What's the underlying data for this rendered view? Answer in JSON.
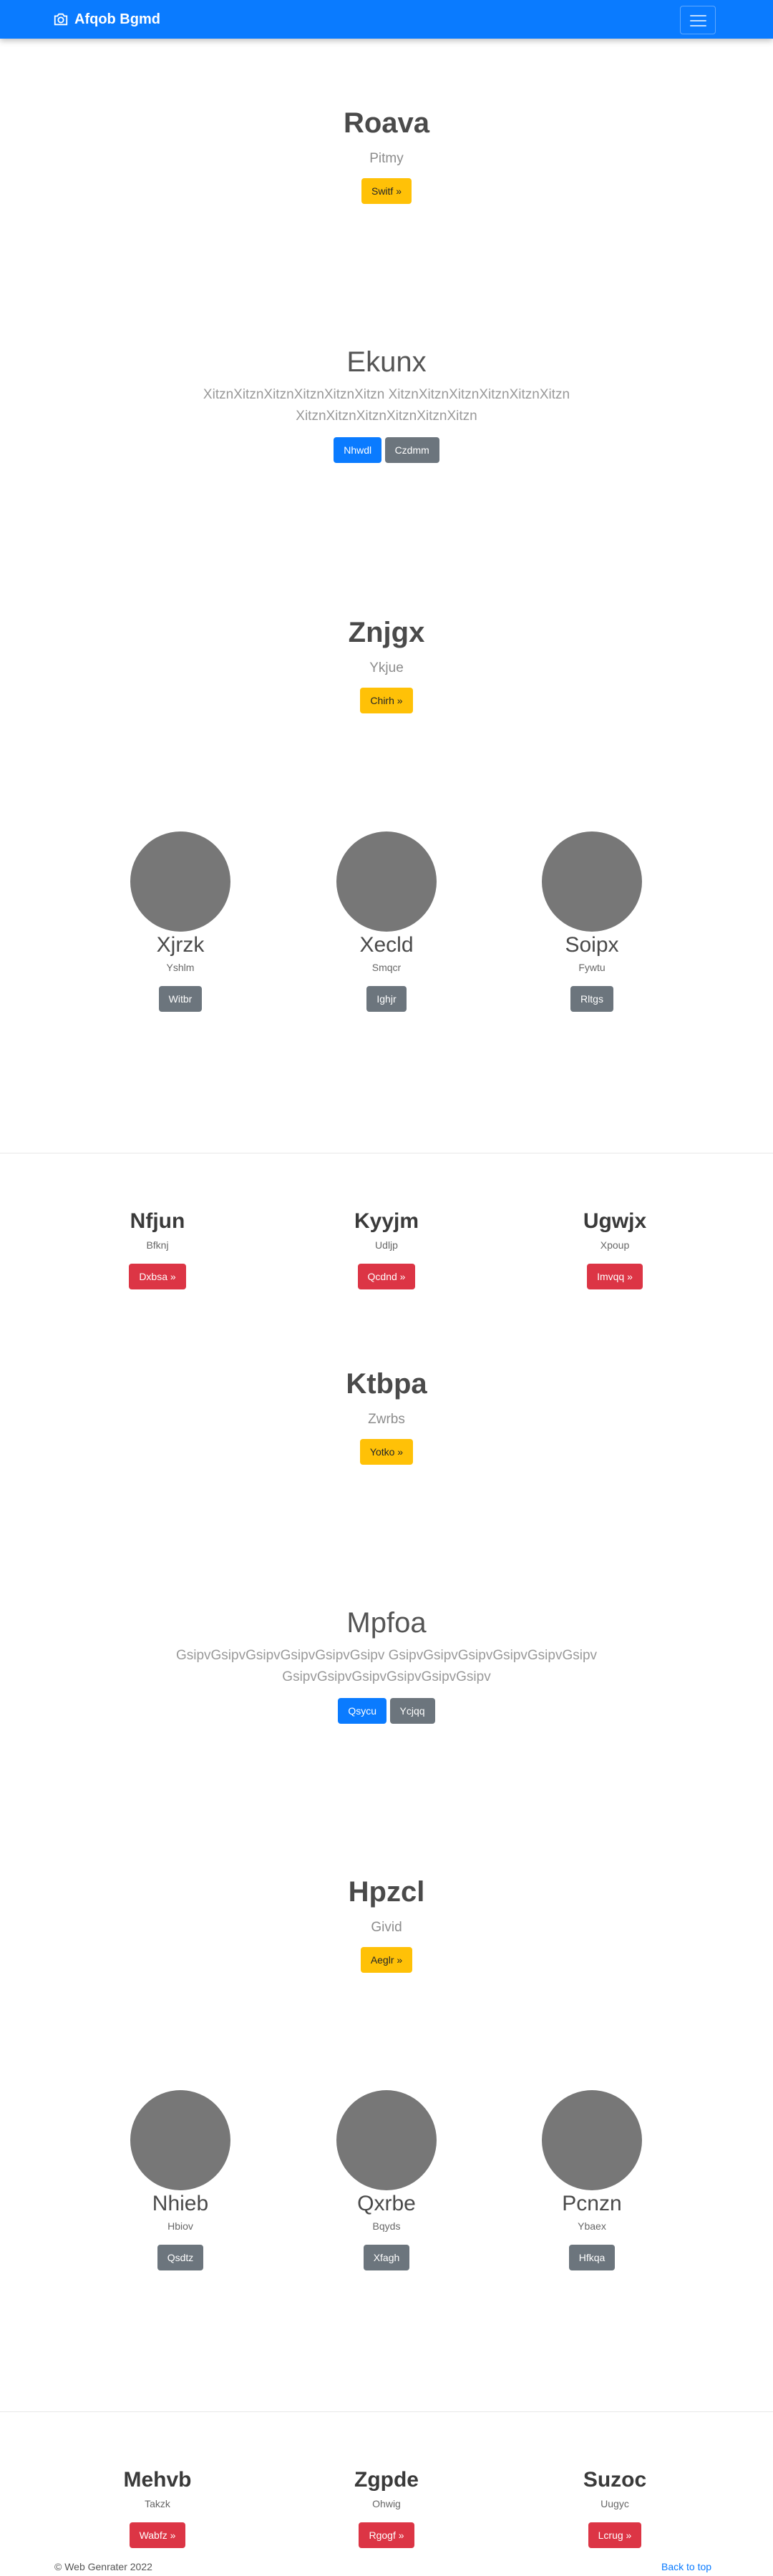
{
  "navbar": {
    "brand": "Afqob Bgmd",
    "brand_icon": "camera-icon"
  },
  "hero1": {
    "title": "Roava",
    "lead": "Pitmy",
    "button": "Switf »"
  },
  "hero2": {
    "title": "Ekunx",
    "text_line1": "XitznXitznXitznXitznXitznXitzn XitznXitznXitznXitznXitznXitzn",
    "text_line2": "XitznXitznXitznXitznXitznXitzn",
    "btn_primary": "Nhwdl",
    "btn_secondary": "Czdmm"
  },
  "hero3": {
    "title": "Znjgx",
    "lead": "Ykjue",
    "button": "Chirh »"
  },
  "circles1": [
    {
      "title": "Xjrzk",
      "sub": "Yshlm",
      "button": "Witbr"
    },
    {
      "title": "Xecld",
      "sub": "Smqcr",
      "button": "Ighjr"
    },
    {
      "title": "Soipx",
      "sub": "Fywtu",
      "button": "Rltgs"
    }
  ],
  "cols1": [
    {
      "title": "Nfjun",
      "sub": "Bfknj",
      "button": "Dxbsa »"
    },
    {
      "title": "Kyyjm",
      "sub": "Udljp",
      "button": "Qcdnd »"
    },
    {
      "title": "Ugwjx",
      "sub": "Xpoup",
      "button": "Imvqq »"
    }
  ],
  "hero4": {
    "title": "Ktbpa",
    "lead": "Zwrbs",
    "button": "Yotko »"
  },
  "hero5": {
    "title": "Mpfoa",
    "text_line1": "GsipvGsipvGsipvGsipvGsipvGsipv GsipvGsipvGsipvGsipvGsipvGsipv",
    "text_line2": "GsipvGsipvGsipvGsipvGsipvGsipv",
    "btn_primary": "Qsycu",
    "btn_secondary": "Ycjqq"
  },
  "hero6": {
    "title": "Hpzcl",
    "lead": "Givid",
    "button": "Aeglr »"
  },
  "circles2": [
    {
      "title": "Nhieb",
      "sub": "Hbiov",
      "button": "Qsdtz"
    },
    {
      "title": "Qxrbe",
      "sub": "Bqyds",
      "button": "Xfagh"
    },
    {
      "title": "Pcnzn",
      "sub": "Ybaex",
      "button": "Hfkqa"
    }
  ],
  "cols2": [
    {
      "title": "Mehvb",
      "sub": "Takzk",
      "button": "Wabfz »"
    },
    {
      "title": "Zgpde",
      "sub": "Ohwig",
      "button": "Rgogf »"
    },
    {
      "title": "Suzoc",
      "sub": "Uugyc",
      "button": "Lcrug »"
    }
  ],
  "footer": {
    "copyright": "© Web Genrater 2022",
    "back_to_top": "Back to top"
  },
  "colors": {
    "primary": "#0a7bff",
    "warning": "#ffc107",
    "secondary": "#6c757d",
    "danger": "#dc3545",
    "placeholder": "#777777"
  }
}
